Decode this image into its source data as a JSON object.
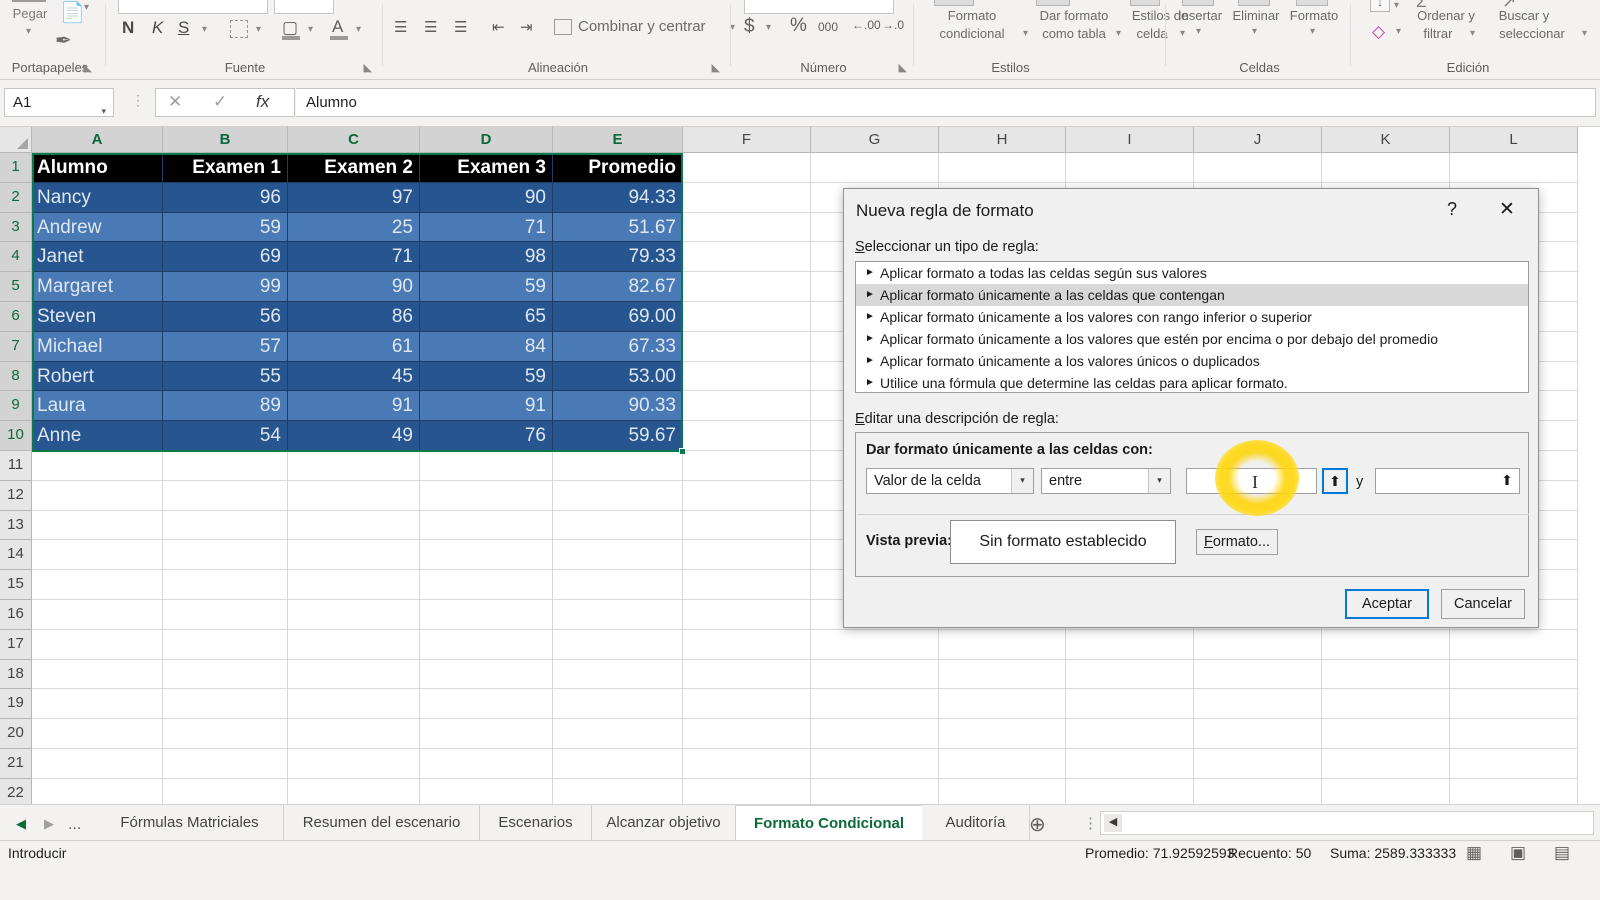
{
  "ribbon": {
    "groups": [
      {
        "name": "Portapapeles"
      },
      {
        "name": "Fuente"
      },
      {
        "name": "Alineación"
      },
      {
        "name": "Número"
      },
      {
        "name": "Estilos"
      },
      {
        "name": "Celdas"
      },
      {
        "name": "Edición"
      }
    ],
    "clipboard": {
      "paste_label": "Pegar"
    },
    "font": {
      "bold": "N",
      "italic": "K",
      "underline": "S"
    },
    "alignment": {
      "merge_label": "Combinar y centrar"
    },
    "number": {
      "currency": "$",
      "percent": "%",
      "thousands": "000"
    },
    "styles": {
      "conditional_l1": "Formato",
      "conditional_l2": "condicional",
      "table_l1": "Dar formato",
      "table_l2": "como tabla",
      "cellstyles_l1": "Estilos de",
      "cellstyles_l2": "celda"
    },
    "cells": {
      "insert": "Insertar",
      "delete": "Eliminar",
      "format": "Formato"
    },
    "editing": {
      "sort_l1": "Ordenar y",
      "sort_l2": "filtrar",
      "find_l1": "Buscar y",
      "find_l2": "seleccionar"
    }
  },
  "formula_bar": {
    "name_box": "A1",
    "cancel_icon": "cancel-icon",
    "confirm_icon": "confirm-icon",
    "function_icon": "fx",
    "content": "Alumno"
  },
  "grid": {
    "columns": [
      "A",
      "B",
      "C",
      "D",
      "E",
      "F",
      "G",
      "H",
      "I",
      "J",
      "K",
      "L"
    ],
    "rows": [
      1,
      2,
      3,
      4,
      5,
      6,
      7,
      8,
      9,
      10,
      11,
      12,
      13,
      14,
      15,
      16,
      17,
      18,
      19,
      20,
      21,
      22
    ],
    "headers": [
      "Alumno",
      "Examen 1",
      "Examen 2",
      "Examen 3",
      "Promedio"
    ],
    "data": [
      {
        "alumno": "Nancy",
        "e1": "96",
        "e2": "97",
        "e3": "90",
        "prom": "94.33"
      },
      {
        "alumno": "Andrew",
        "e1": "59",
        "e2": "25",
        "e3": "71",
        "prom": "51.67"
      },
      {
        "alumno": "Janet",
        "e1": "69",
        "e2": "71",
        "e3": "98",
        "prom": "79.33"
      },
      {
        "alumno": "Margaret",
        "e1": "99",
        "e2": "90",
        "e3": "59",
        "prom": "82.67"
      },
      {
        "alumno": "Steven",
        "e1": "56",
        "e2": "86",
        "e3": "65",
        "prom": "69.00"
      },
      {
        "alumno": "Michael",
        "e1": "57",
        "e2": "61",
        "e3": "84",
        "prom": "67.33"
      },
      {
        "alumno": "Robert",
        "e1": "55",
        "e2": "45",
        "e3": "59",
        "prom": "53.00"
      },
      {
        "alumno": "Laura",
        "e1": "89",
        "e2": "91",
        "e3": "91",
        "prom": "90.33"
      },
      {
        "alumno": "Anne",
        "e1": "54",
        "e2": "49",
        "e3": "76",
        "prom": "59.67"
      }
    ]
  },
  "sheet_tabs": {
    "overflow": "...",
    "tabs": [
      {
        "label": "Fórmulas Matriciales",
        "active": false
      },
      {
        "label": "Resumen del escenario",
        "active": false
      },
      {
        "label": "Escenarios",
        "active": false
      },
      {
        "label": "Alcanzar objetivo",
        "active": false
      },
      {
        "label": "Formato Condicional",
        "active": true
      },
      {
        "label": "Auditoría",
        "active": false
      }
    ],
    "add_label": "+"
  },
  "status_bar": {
    "mode": "Introducir",
    "average": "Promedio: 71.92592593",
    "count": "Recuento: 50",
    "sum": "Suma: 2589.333333"
  },
  "dialog": {
    "title": "Nueva regla de formato",
    "help_label": "?",
    "close_label": "✕",
    "select_rule_label": "Seleccionar un tipo de regla:",
    "rules": [
      {
        "label": "Aplicar formato a todas las celdas según sus valores",
        "selected": false
      },
      {
        "label": "Aplicar formato únicamente a las celdas que contengan",
        "selected": true
      },
      {
        "label": "Aplicar formato únicamente a los valores con rango inferior o superior",
        "selected": false
      },
      {
        "label": "Aplicar formato únicamente a los valores que estén por encima o por debajo del promedio",
        "selected": false
      },
      {
        "label": "Aplicar formato únicamente a los valores únicos o duplicados",
        "selected": false
      },
      {
        "label": "Utilice una fórmula que determine las celdas para aplicar formato.",
        "selected": false
      }
    ],
    "edit_rule_label": "Editar una descripción de regla:",
    "format_cells_label": "Dar formato únicamente a las celdas con:",
    "condition_type": "Valor de la celda",
    "operator": "entre",
    "value1": "",
    "value2": "",
    "between_label": "y",
    "range_picker_icon": "range-picker-icon",
    "preview_label": "Vista previa:",
    "preview_text": "Sin formato establecido",
    "format_button": "Formato...",
    "ok_button": "Aceptar",
    "cancel_button": "Cancelar"
  }
}
